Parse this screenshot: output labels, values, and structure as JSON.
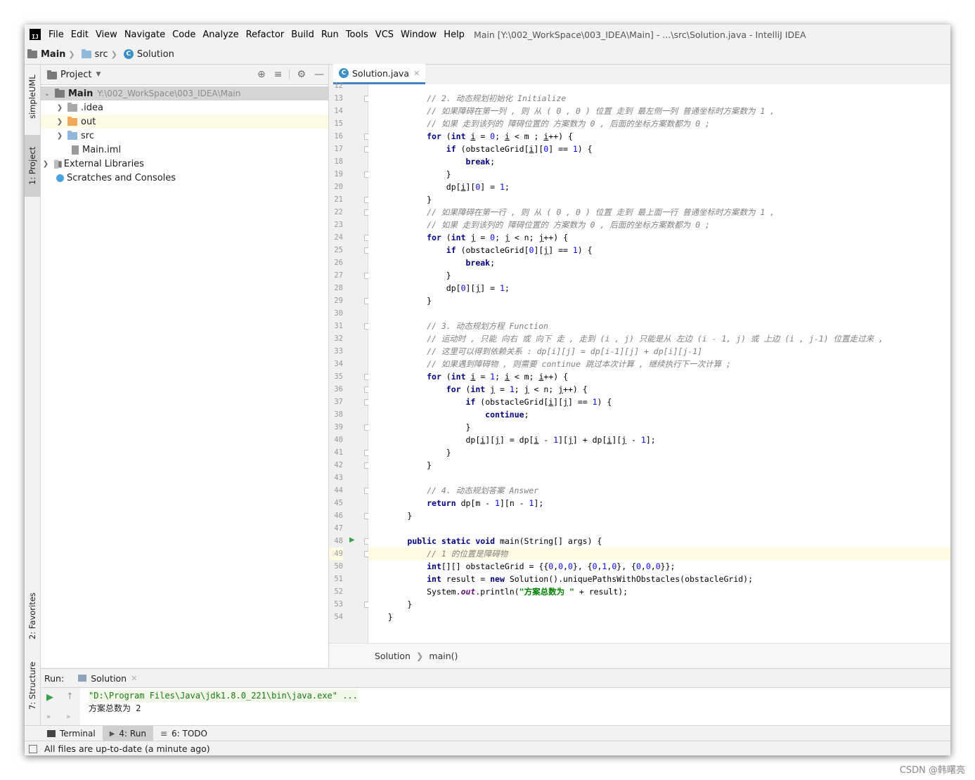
{
  "menubar": {
    "items": [
      "File",
      "Edit",
      "View",
      "Navigate",
      "Code",
      "Analyze",
      "Refactor",
      "Build",
      "Run",
      "Tools",
      "VCS",
      "Window",
      "Help"
    ],
    "title": "Main [Y:\\002_WorkSpace\\003_IDEA\\Main] - ...\\src\\Solution.java - IntelliJ IDEA"
  },
  "navbar": {
    "crumbs": [
      "Main",
      "src",
      "Solution"
    ]
  },
  "left_strip": {
    "tabs": [
      "simpleUML",
      "1: Project",
      "2: Favorites",
      "7: Structure"
    ]
  },
  "project": {
    "header": "Project",
    "tree": [
      {
        "label": "Main",
        "path": "Y:\\002_WorkSpace\\003_IDEA\\Main"
      },
      {
        "label": ".idea"
      },
      {
        "label": "out"
      },
      {
        "label": "src"
      },
      {
        "label": "Main.iml"
      },
      {
        "label": "External Libraries"
      },
      {
        "label": "Scratches and Consoles"
      }
    ]
  },
  "editor": {
    "tab": "Solution.java",
    "breadcrumb": [
      "Solution",
      "main()"
    ],
    "lines": [
      {
        "n": "12",
        "html": ""
      },
      {
        "n": "13",
        "html": "            <span class='cm'>// 2. 动态规划初始化 Initialize</span>"
      },
      {
        "n": "14",
        "html": "            <span class='cm'>// 如果障碍在第一列 , 则 从 ( 0 , 0 ) 位置 走到 最左侧一列 普通坐标时方案数为 1 ,</span>"
      },
      {
        "n": "15",
        "html": "            <span class='cm'>// 如果 走到该列的 障碍位置的 方案数为 0 , 后面的坐标方案数都为 0 ;</span>"
      },
      {
        "n": "16",
        "html": "            <span class='kw'>for</span> (<span class='kw'>int</span> <span class='ul'>i</span> = <span class='num'>0</span>; <span class='ul'>i</span> &lt; m ; <span class='ul'>i</span>++) {"
      },
      {
        "n": "17",
        "html": "                <span class='kw'>if</span> (obstacleGrid[<span class='ul'>i</span>][<span class='num'>0</span>] == <span class='num'>1</span>) {"
      },
      {
        "n": "18",
        "html": "                    <span class='kw'>break</span>;"
      },
      {
        "n": "19",
        "html": "                }"
      },
      {
        "n": "20",
        "html": "                dp[<span class='ul'>i</span>][<span class='num'>0</span>] = <span class='num'>1</span>;"
      },
      {
        "n": "21",
        "html": "            }"
      },
      {
        "n": "22",
        "html": "            <span class='cm'>// 如果障碍在第一行 , 则 从 ( 0 , 0 ) 位置 走到 最上面一行 普通坐标时方案数为 1 ,</span>"
      },
      {
        "n": "23",
        "html": "            <span class='cm'>// 如果 走到该列的 障碍位置的 方案数为 0 , 后面的坐标方案数都为 0 ;</span>"
      },
      {
        "n": "24",
        "html": "            <span class='kw'>for</span> (<span class='kw'>int</span> <span class='ul'>j</span> = <span class='num'>0</span>; <span class='ul'>j</span> &lt; n; <span class='ul'>j</span>++) {"
      },
      {
        "n": "25",
        "html": "                <span class='kw'>if</span> (obstacleGrid[<span class='num'>0</span>][<span class='ul'>j</span>] == <span class='num'>1</span>) {"
      },
      {
        "n": "26",
        "html": "                    <span class='kw'>break</span>;"
      },
      {
        "n": "27",
        "html": "                }"
      },
      {
        "n": "28",
        "html": "                dp[<span class='num'>0</span>][<span class='ul'>j</span>] = <span class='num'>1</span>;"
      },
      {
        "n": "29",
        "html": "            }"
      },
      {
        "n": "30",
        "html": ""
      },
      {
        "n": "31",
        "html": "            <span class='cm'>// 3. 动态规划方程 Function</span>"
      },
      {
        "n": "32",
        "html": "            <span class='cm'>// 运动时 , 只能 向右 或 向下 走 , 走到 (i , j) 只能是从 左边 (i - 1, j) 或 上边 (i , j-1) 位置走过来 ,</span>"
      },
      {
        "n": "33",
        "html": "            <span class='cm'>// 这里可以得到依赖关系 : dp[i][j] = dp[i-1][j] + dp[i][j-1]</span>"
      },
      {
        "n": "34",
        "html": "            <span class='cm'>// 如果遇到障碍物 , 则需要 continue 跳过本次计算 , 继续执行下一次计算 ;</span>"
      },
      {
        "n": "35",
        "html": "            <span class='kw'>for</span> (<span class='kw'>int</span> <span class='ul'>i</span> = <span class='num'>1</span>; <span class='ul'>i</span> &lt; m; <span class='ul'>i</span>++) {"
      },
      {
        "n": "36",
        "html": "                <span class='kw'>for</span> (<span class='kw'>int</span> <span class='ul'>j</span> = <span class='num'>1</span>; <span class='ul'>j</span> &lt; n; <span class='ul'>j</span>++) {"
      },
      {
        "n": "37",
        "html": "                    <span class='kw'>if</span> (obstacleGrid[<span class='ul'>i</span>][<span class='ul'>j</span>] == <span class='num'>1</span>) {"
      },
      {
        "n": "38",
        "html": "                        <span class='kw'>continue</span>;"
      },
      {
        "n": "39",
        "html": "                    }"
      },
      {
        "n": "40",
        "html": "                    dp[<span class='ul'>i</span>][<span class='ul'>j</span>] = dp[<span class='ul'>i</span> - <span class='num'>1</span>][<span class='ul'>j</span>] + dp[<span class='ul'>i</span>][<span class='ul'>j</span> - <span class='num'>1</span>];"
      },
      {
        "n": "41",
        "html": "                }"
      },
      {
        "n": "42",
        "html": "            }"
      },
      {
        "n": "43",
        "html": ""
      },
      {
        "n": "44",
        "html": "            <span class='cm'>// 4. 动态规划答案 Answer</span>"
      },
      {
        "n": "45",
        "html": "            <span class='kw'>return</span> dp[m - <span class='num'>1</span>][n - <span class='num'>1</span>];"
      },
      {
        "n": "46",
        "html": "        }"
      },
      {
        "n": "47",
        "html": ""
      },
      {
        "n": "48",
        "html": "        <span class='kw'>public static void</span> main(String[] args) {"
      },
      {
        "n": "49",
        "html": "            <span class='cm'>// 1 的位置是障碍物</span>"
      },
      {
        "n": "50",
        "html": "            <span class='kw'>int</span>[][] obstacleGrid = {{<span class='num'>0</span>,<span class='num'>0</span>,<span class='num'>0</span>}, {<span class='num'>0</span>,<span class='num'>1</span>,<span class='num'>0</span>}, {<span class='num'>0</span>,<span class='num'>0</span>,<span class='num'>0</span>}};"
      },
      {
        "n": "51",
        "html": "            <span class='kw'>int</span> result = <span class='kw'>new</span> Solution().uniquePathsWithObstacles(obstacleGrid);"
      },
      {
        "n": "52",
        "html": "            System.<span class='st'>out</span>.println(<span class='str'>\"方案总数为 \"</span> + result);"
      },
      {
        "n": "53",
        "html": "        }"
      },
      {
        "n": "54",
        "html": "    }"
      }
    ]
  },
  "run": {
    "label": "Run:",
    "tab": "Solution",
    "output": [
      "\"D:\\Program Files\\Java\\jdk1.8.0_221\\bin\\java.exe\" ...",
      "方案总数为 2"
    ]
  },
  "bottom_tabs": [
    "Terminal",
    "4: Run",
    "6: TODO"
  ],
  "status": "All files are up-to-date (a minute ago)",
  "watermark": "CSDN @韩曙亮"
}
